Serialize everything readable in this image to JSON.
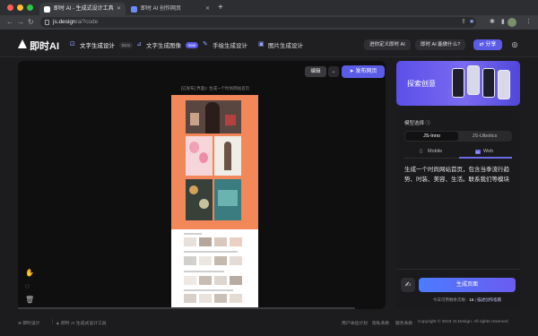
{
  "browser": {
    "tabs": [
      {
        "title": "即时 AI - 生成式设计工具",
        "active": true
      },
      {
        "title": "即时 AI 创作网页",
        "active": false
      }
    ],
    "url_host": "js.design",
    "url_path": "/ai?code"
  },
  "header": {
    "logo": "即时AI",
    "nav": [
      {
        "label": "文字生成设计",
        "badge": "Beta",
        "icon": "text-design-icon"
      },
      {
        "label": "文字生成图像",
        "badge": "new",
        "icon": "text-image-icon"
      },
      {
        "label": "手绘生成设计",
        "icon": "sketch-icon"
      },
      {
        "label": "图片生成设计",
        "icon": "image-design-icon"
      }
    ],
    "buttons": {
      "customize": "进你定义即时 AI",
      "about": "即时 AI 能做什么?",
      "share": "分享"
    }
  },
  "canvas": {
    "edit_label": "编辑",
    "publish_label": "发布网页",
    "preview_title": "[已发布] 界面1: 生成一个时尚网站首页"
  },
  "panel": {
    "banner_text": "探索创意",
    "model_label": "模型选择",
    "models": [
      "JS-Inno",
      "JS-Uibotics"
    ],
    "selected_model": "JS-Inno",
    "devices": [
      "Mobile",
      "Web"
    ],
    "selected_device": "Web",
    "prompt_text": "生成一个时尚网站首页，包含当季流行趋势、时装、美容、生活。联系我们等模块",
    "generate_label": "生成页面",
    "remaining_prefix": "今日可用剩余次数：",
    "remaining_count": "15",
    "guide_link": "描述创作指南"
  },
  "footer": {
    "brand": "即时设计",
    "product": "即时 AI 生成式设计工具",
    "links": [
      "用户体验计划",
      "隐私条款",
      "服务条款"
    ],
    "copyright": "Copyright © 2023 Js.Design. All rights reserved"
  },
  "colors": {
    "accent": "#5b5ce6",
    "hero": "#f2875a",
    "background": "#1c1c1e"
  }
}
